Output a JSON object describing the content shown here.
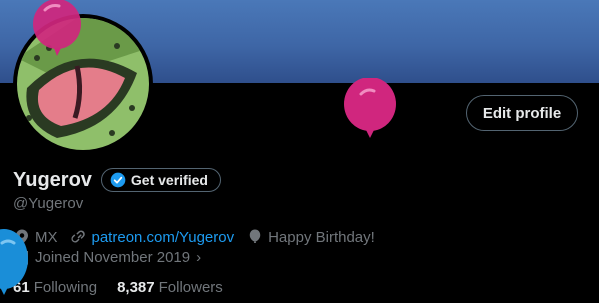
{
  "profile": {
    "display_name": "Yugerov",
    "handle": "@Yugerov",
    "location": "MX",
    "website": "patreon.com/Yugerov",
    "birthday": "Happy Birthday!",
    "joined": "Joined November 2019",
    "following_count": "61",
    "following_label": "Following",
    "followers_count": "8,387",
    "followers_label": "Followers"
  },
  "actions": {
    "edit_profile": "Edit profile",
    "get_verified": "Get verified"
  },
  "icons": {
    "location": "location-pin-icon",
    "link": "link-icon",
    "birthday": "balloon-icon",
    "calendar": "calendar-icon",
    "verified": "verified-badge-icon",
    "chevron": "chevron-right-icon"
  },
  "colors": {
    "background": "#000000",
    "banner": "#3e66a6",
    "accent": "#1d9bf0",
    "text_primary": "#e7e9ea",
    "text_secondary": "#71767b",
    "balloon_pink": "#d0267e",
    "balloon_blue": "#1a8ed8"
  }
}
